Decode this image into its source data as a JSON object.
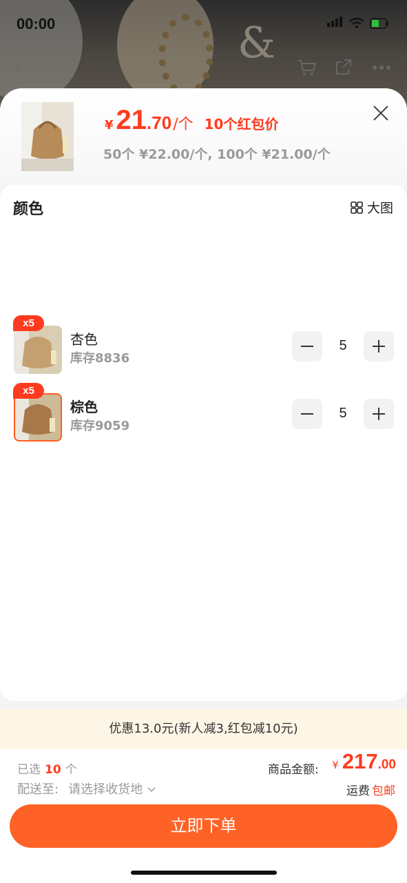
{
  "status_bar": {
    "time": "00:00"
  },
  "background": {
    "decor": "&"
  },
  "header": {
    "currency": "¥",
    "price_int": "21",
    "price_dec": ".70",
    "price_unit": "/个",
    "price_tag": "10个红包价",
    "tiers": "50个 ¥22.00/个, 100个 ¥21.00/个"
  },
  "panel": {
    "section_title": "颜色",
    "big_image_label": "大图",
    "items": [
      {
        "badge": "x5",
        "name": "杏色",
        "stock": "库存8836",
        "qty": "5"
      },
      {
        "badge": "x5",
        "name": "棕色",
        "stock": "库存9059",
        "qty": "5"
      }
    ]
  },
  "discount": "优惠13.0元(新人减3,红包减10元)",
  "footer": {
    "selected_prefix": "已选",
    "selected_count": "10",
    "selected_unit": "个",
    "ship_label": "配送至:",
    "ship_placeholder": "请选择收货地",
    "total_label": "商品金额:",
    "total_currency": "¥",
    "total_int": "217",
    "total_dec": ".00",
    "freight_label": "运费",
    "freight_value": "包邮",
    "order_button": "立即下单"
  },
  "colors": {
    "accent": "#ff3b1f",
    "button": "#ff6226",
    "discount_bg": "#fdf6e6"
  }
}
